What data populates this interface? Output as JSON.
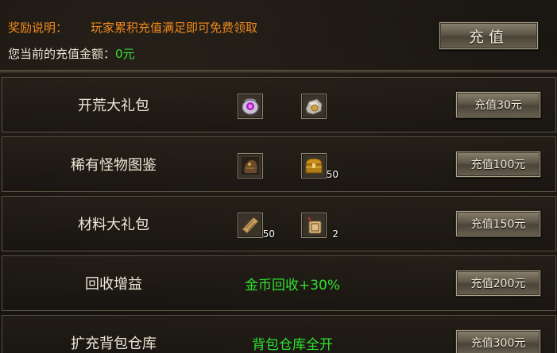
{
  "header": {
    "notice_label": "奖励说明：",
    "notice_text": "玩家累积充值满足即可免费领取",
    "amount_label": "您当前的充值金额：",
    "amount_value": "0元",
    "recharge_button": "充值"
  },
  "rows": [
    {
      "title": "开荒大礼包",
      "items": [
        {
          "icon": "purple-gem-bag-icon",
          "count": ""
        },
        {
          "icon": "silver-ore-icon",
          "count": ""
        }
      ],
      "button": "充值30元"
    },
    {
      "title": "稀有怪物图鉴",
      "items": [
        {
          "icon": "monster-card-icon",
          "count": ""
        },
        {
          "icon": "gold-treasure-chest-icon",
          "count": "50"
        }
      ],
      "button": "充值100元"
    },
    {
      "title": "材料大礼包",
      "items": [
        {
          "icon": "scroll-icon",
          "count": "50"
        },
        {
          "icon": "charm-token-icon",
          "count": "2"
        }
      ],
      "button": "充值150元"
    },
    {
      "title": "回收增益",
      "bonus": "金币回收+30%",
      "button": "充值200元"
    },
    {
      "title": "扩充背包仓库",
      "bonus": "背包仓库全开",
      "button": "充值300元"
    }
  ],
  "colors": {
    "notice": "#f08a1c",
    "amount": "#34e034",
    "bonus": "#2fe22f",
    "text": "#efe8d8"
  }
}
